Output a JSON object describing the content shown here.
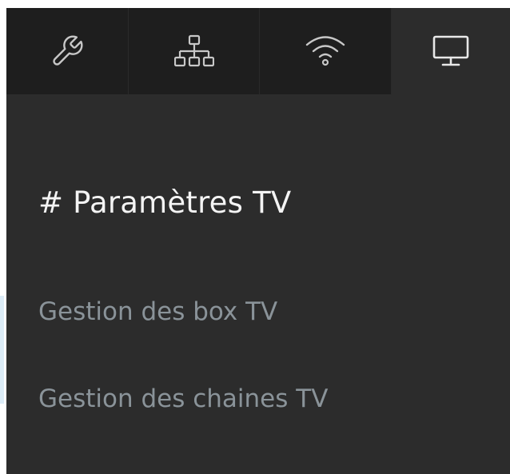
{
  "tabs": [
    {
      "icon": "wrench-icon",
      "active": false
    },
    {
      "icon": "network-icon",
      "active": false
    },
    {
      "icon": "wifi-icon",
      "active": false
    },
    {
      "icon": "monitor-icon",
      "active": true
    }
  ],
  "section": {
    "title": "# Paramètres TV"
  },
  "menu": {
    "items": [
      {
        "label": "Gestion des box TV"
      },
      {
        "label": "Gestion des chaines TV"
      }
    ]
  },
  "colors": {
    "panel_bg": "#2c2c2c",
    "tab_bg": "#1e1e1e",
    "title_text": "#f4f4f4",
    "menu_text": "#8a9399",
    "icon_stroke": "#c8c8c8"
  }
}
